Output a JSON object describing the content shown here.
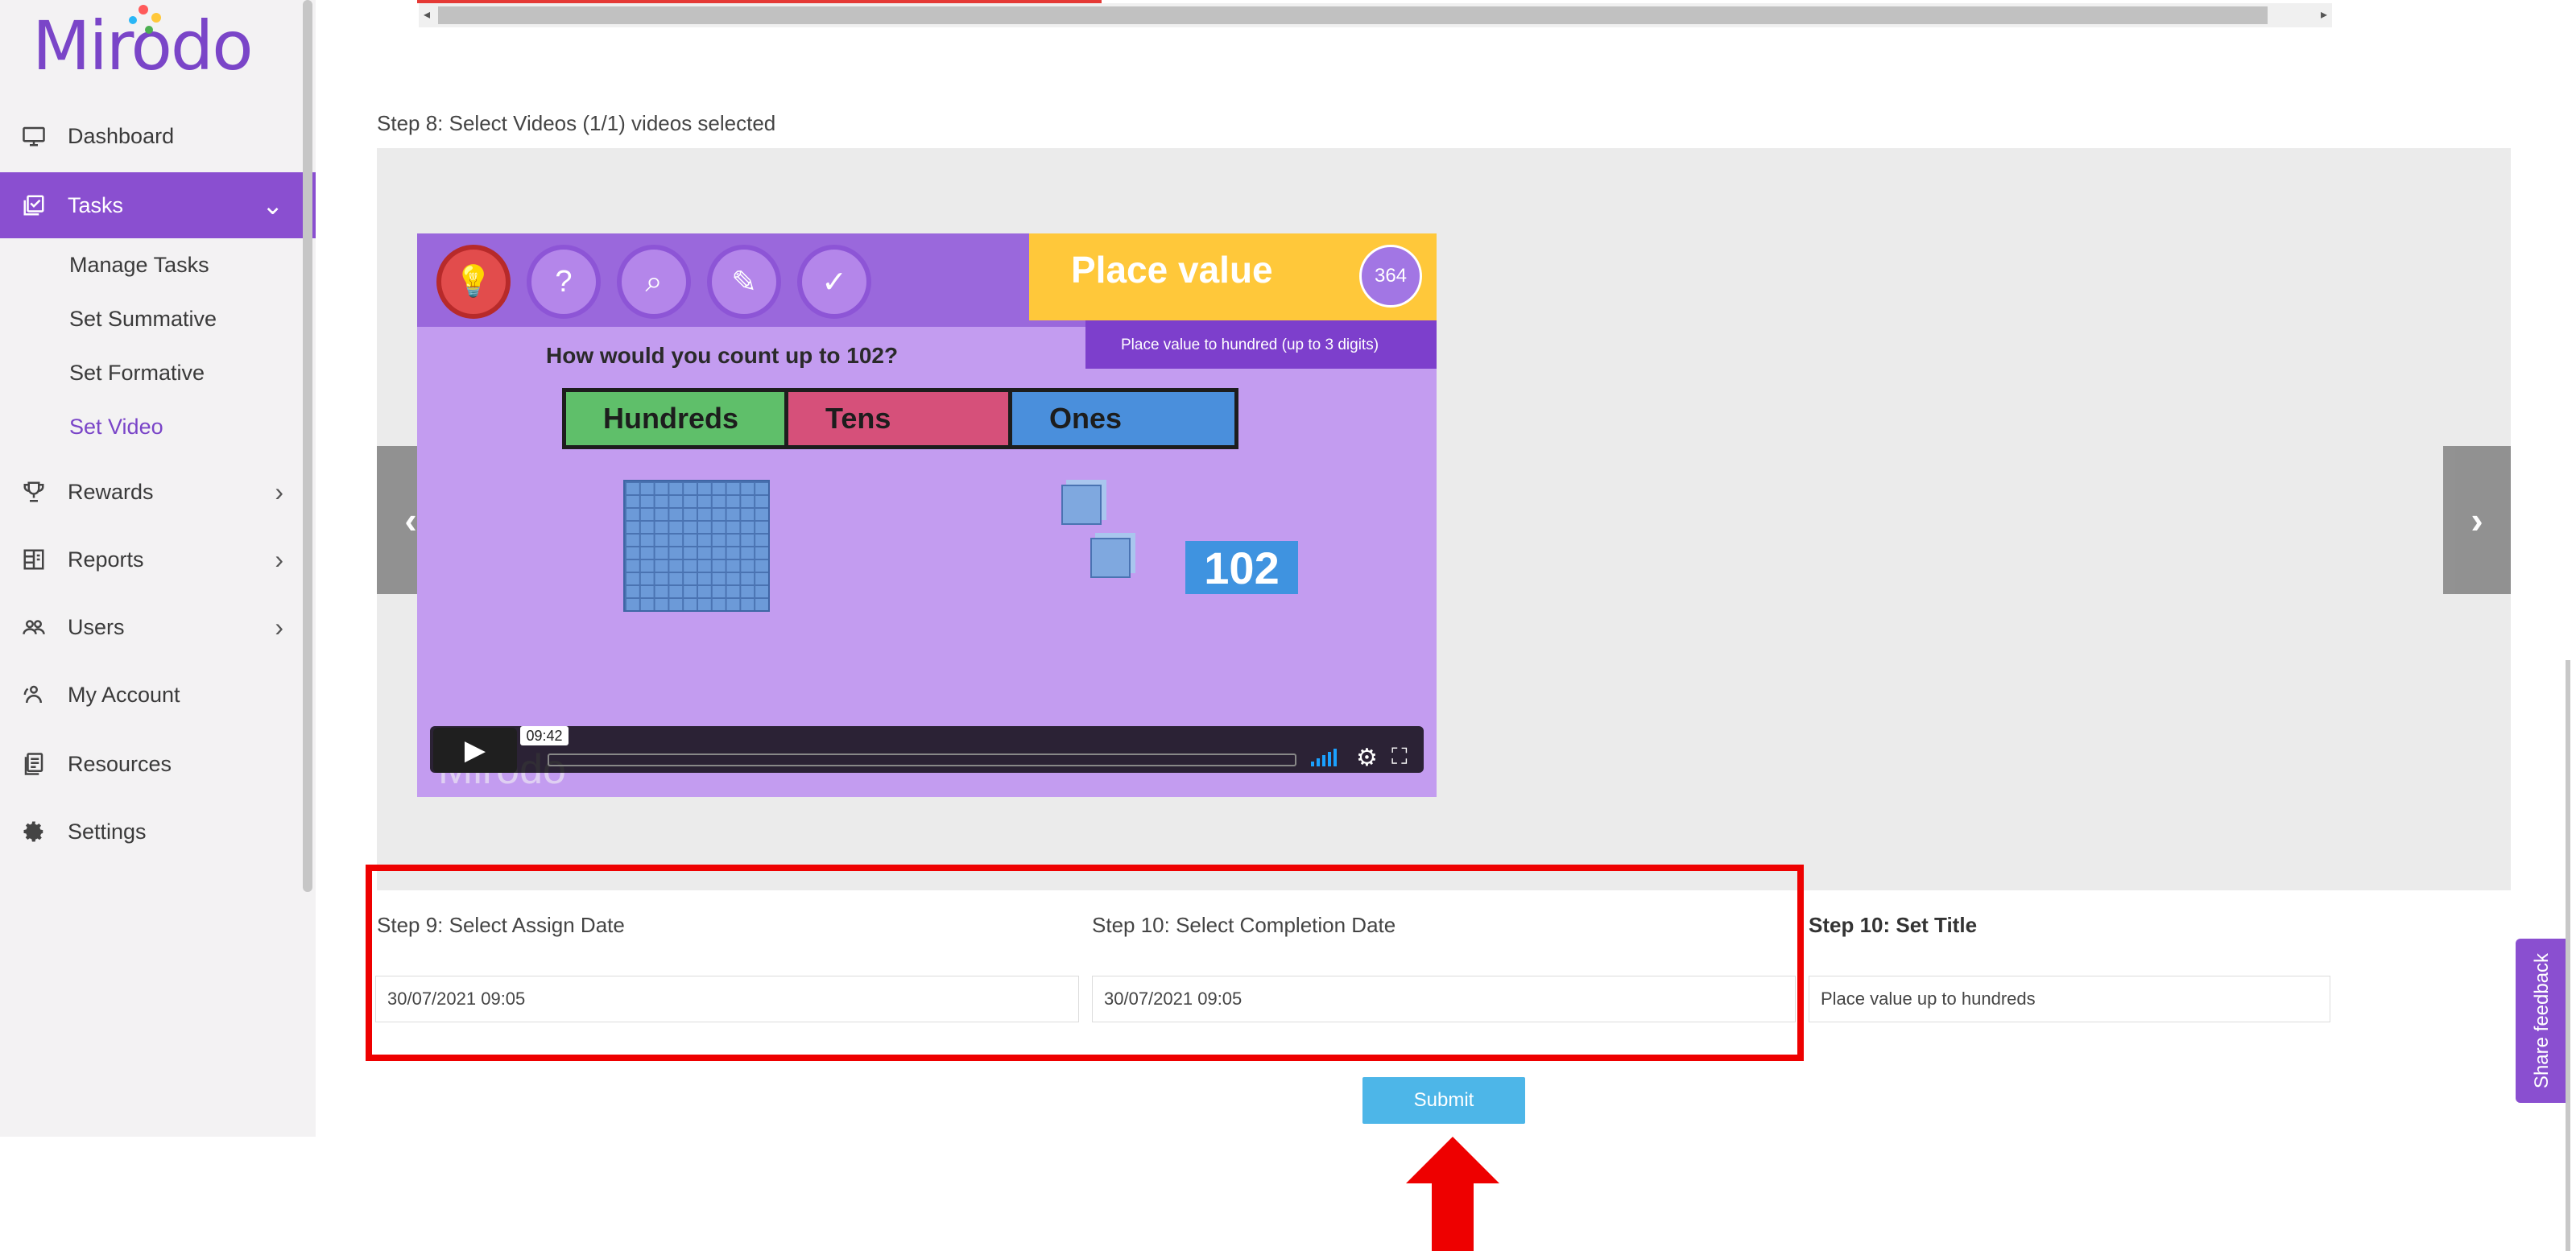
{
  "sidebar": {
    "logo": "Mirodo",
    "items": [
      {
        "label": "Dashboard",
        "icon": "monitor-icon"
      },
      {
        "label": "Tasks",
        "icon": "task-check-icon",
        "active": true,
        "expanded": true
      },
      {
        "label": "Rewards",
        "icon": "trophy-icon"
      },
      {
        "label": "Reports",
        "icon": "report-grid-icon"
      },
      {
        "label": "Users",
        "icon": "users-icon"
      },
      {
        "label": "My Account",
        "icon": "account-icon"
      },
      {
        "label": "Resources",
        "icon": "resources-icon"
      },
      {
        "label": "Settings",
        "icon": "gear-icon"
      }
    ],
    "task_subitems": [
      "Manage Tasks",
      "Set Summative",
      "Set Formative",
      "Set Video"
    ],
    "current_subitem": "Set Video"
  },
  "main": {
    "step8_label": "Step 8: Select Videos (1/1) videos selected",
    "video": {
      "title": "Place value",
      "badge": "364",
      "subtitle": "Place value to hundred (up to 3 digits)",
      "question": "How would you count up to 102?",
      "columns": [
        "Hundreds",
        "Tens",
        "Ones"
      ],
      "number": "102",
      "watermark": "Mirodo",
      "duration": "09:42"
    },
    "step9_label": "Step 9: Select Assign Date",
    "step10_completion_label": "Step 10: Select Completion Date",
    "step10_title_label": "Step 10: Set Title",
    "assign_date": "30/07/2021 09:05",
    "completion_date": "30/07/2021 09:05",
    "title_value": "Place value up to hundreds",
    "submit_label": "Submit",
    "feedback_label": "Share feedback"
  },
  "colors": {
    "brand_purple": "#8a4fd0",
    "submit_blue": "#4db6e8",
    "highlight_red": "#ee0000"
  }
}
